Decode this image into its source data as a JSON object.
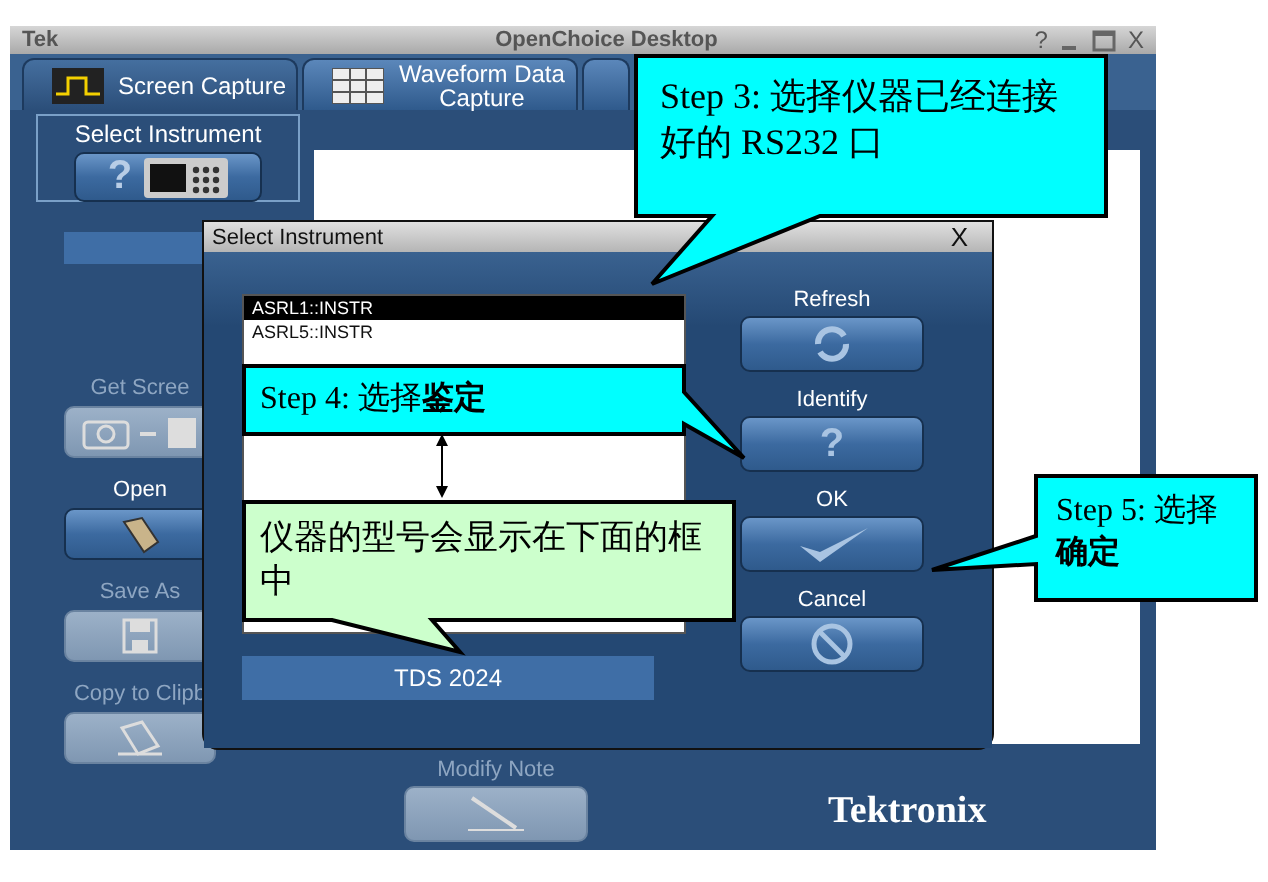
{
  "window": {
    "app_label": "Tek",
    "title": "OpenChoice Desktop",
    "help": "?",
    "close": "X"
  },
  "tabs": [
    {
      "label": "Screen Capture",
      "kind": "screen",
      "selected": true
    },
    {
      "label": "Waveform Data Capture",
      "kind": "waveform",
      "selected": false
    }
  ],
  "sidebar": {
    "select_instrument": {
      "label": "Select Instrument",
      "icon_char": "?"
    },
    "actions": [
      {
        "label": "Get Scree",
        "kind": "capture",
        "disabled": true
      },
      {
        "label": "Open",
        "kind": "open",
        "disabled": false
      },
      {
        "label": "Save As",
        "kind": "save",
        "disabled": true
      },
      {
        "label": "Copy to Clipb",
        "kind": "clipboard",
        "disabled": true
      }
    ]
  },
  "modify_note": {
    "label": "Modify Note",
    "disabled": true
  },
  "brand": "Tektronix",
  "dialog": {
    "title": "Select Instrument",
    "close": "X",
    "instruments": [
      {
        "name": "ASRL1::INSTR",
        "selected": true
      },
      {
        "name": "ASRL5::INSTR",
        "selected": false
      }
    ],
    "model": "TDS 2024",
    "buttons": [
      {
        "label": "Refresh",
        "kind": "refresh"
      },
      {
        "label": "Identify",
        "kind": "identify",
        "icon_char": "?"
      },
      {
        "label": "OK",
        "kind": "ok"
      },
      {
        "label": "Cancel",
        "kind": "cancel"
      }
    ]
  },
  "callouts": [
    {
      "text": "Step 3: 选择仪器已经连接好的 RS232 口",
      "color": "#00ffff"
    },
    {
      "text": "Step 4: 选择**鉴定**",
      "color": "#00ffff"
    },
    {
      "text": "仪器的型号会显示在下面的框中",
      "color": "#ccffcc"
    },
    {
      "text": "Step 5: 选择**确定**",
      "color": "#00ffff"
    }
  ]
}
